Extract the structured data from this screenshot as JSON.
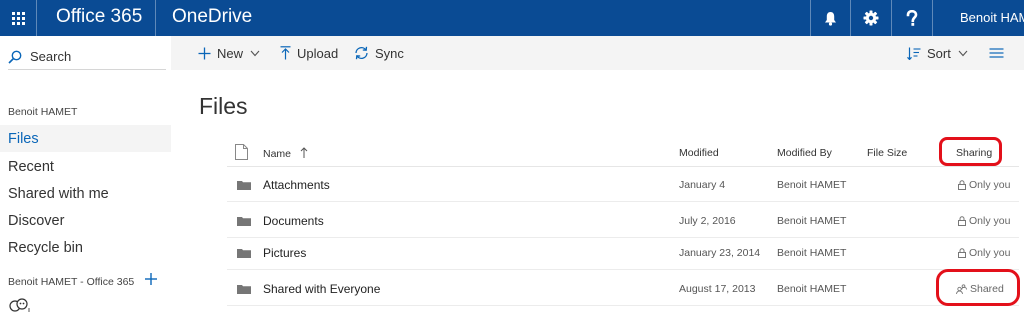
{
  "suitebar": {
    "brand": "Office 365",
    "app": "OneDrive",
    "user": "Benoit HAMET"
  },
  "leftnav": {
    "search_label": "Search",
    "owner_heading": "Benoit HAMET",
    "items": [
      {
        "label": "Files"
      },
      {
        "label": "Recent"
      },
      {
        "label": "Shared with me"
      },
      {
        "label": "Discover"
      },
      {
        "label": "Recycle bin"
      }
    ],
    "group_heading": "Benoit HAMET - Office 365"
  },
  "commands": {
    "new": "New",
    "upload": "Upload",
    "sync": "Sync",
    "sort": "Sort"
  },
  "main": {
    "title": "Files",
    "columns": {
      "name": "Name",
      "modified": "Modified",
      "modified_by": "Modified By",
      "file_size": "File Size",
      "sharing": "Sharing"
    },
    "files": [
      {
        "name": "Attachments",
        "modified": "January 4",
        "modified_by": "Benoit HAMET",
        "sharing": "Only you",
        "sharing_icon": "lock-icon"
      },
      {
        "name": "Documents",
        "modified": "July 2, 2016",
        "modified_by": "Benoit HAMET",
        "sharing": "Only you",
        "sharing_icon": "lock-icon"
      },
      {
        "name": "Pictures",
        "modified": "January 23, 2014",
        "modified_by": "Benoit HAMET",
        "sharing": "Only you",
        "sharing_icon": "lock-icon"
      },
      {
        "name": "Shared with Everyone",
        "modified": "August 17, 2013",
        "modified_by": "Benoit HAMET",
        "sharing": "Shared",
        "sharing_icon": "people-icon"
      }
    ]
  },
  "colors": {
    "suitebar": "#0a4b94",
    "accent": "#0a66b8",
    "annotation": "#e3101a"
  }
}
